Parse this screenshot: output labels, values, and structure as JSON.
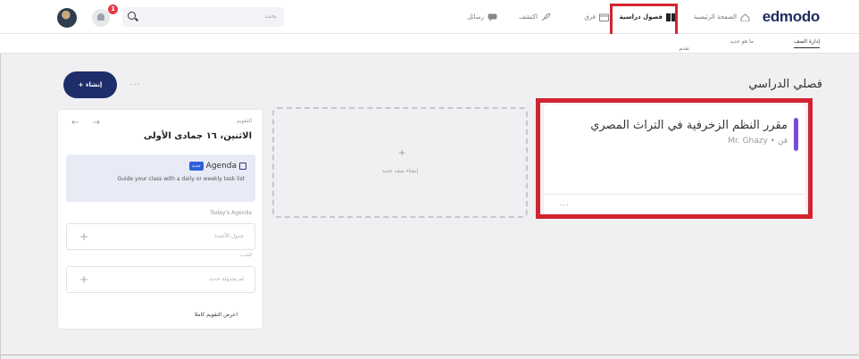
{
  "header": {
    "logo": "edmodo",
    "nav": {
      "home": "الصفحة الرئيسية",
      "classes": "فصول دراسية",
      "teams": "فرق",
      "discover": "اكتشف",
      "messages": "رسائل"
    },
    "search_placeholder": "بحث",
    "notification_count": "1"
  },
  "subnav": {
    "manage": "إدارة الصف",
    "new": "ما هو جديد",
    "advance": "تقدم"
  },
  "page": {
    "title": "فصلي الدراسي",
    "create_button": "+ إنشاء",
    "more": "..."
  },
  "calendar": {
    "label": "التقويم",
    "arrows": "← →",
    "date": "الاثنين، ١٦ جمادى الأولى",
    "agenda": {
      "new_badge": "جديد",
      "title": "Agenda",
      "description": "Guide your class with a daily or weekly task list"
    },
    "todays_agenda": "Today's Agenda",
    "slot1_text": "جدول الأجندة",
    "events_label": "الحدث",
    "slot2_text": "لم يجدولة حدث",
    "full_calendar": "اعرض التقويم كاملا"
  },
  "new_class": {
    "plus": "+",
    "label": "إنشاء صف جديد"
  },
  "class_card": {
    "name": "مقرر النظم الزخرفية في التراث المصري",
    "meta": "Mr. Ghazy • فن",
    "dots": "..."
  },
  "colors": {
    "highlight": "#d3232f",
    "brand": "#1f2d6b",
    "accent": "#7b4bd6"
  }
}
